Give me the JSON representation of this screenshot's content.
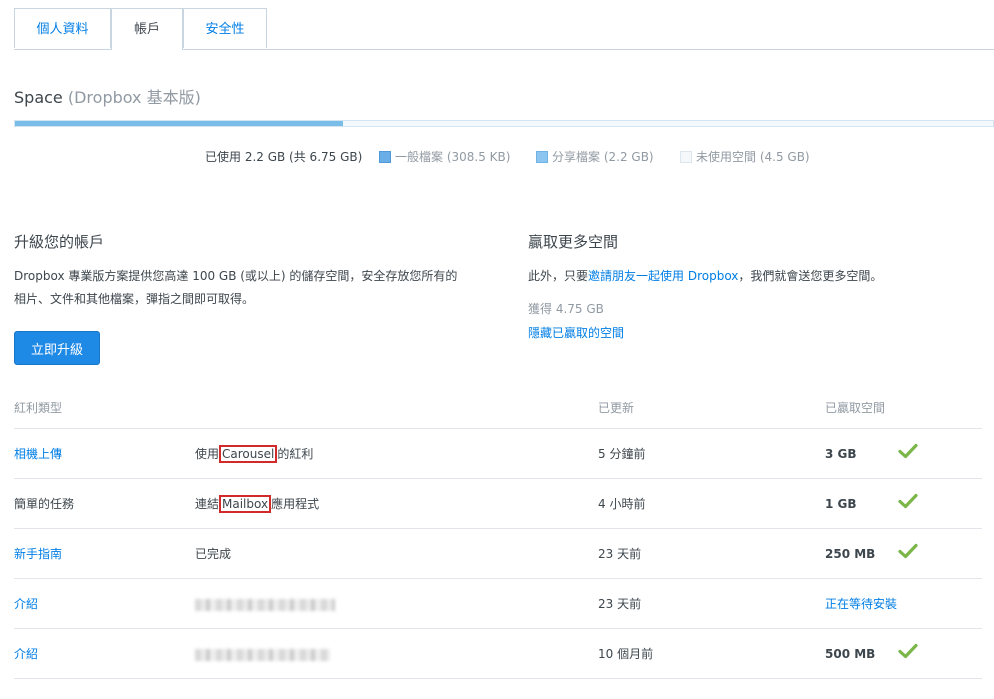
{
  "tabs": [
    {
      "label": "個人資料",
      "active": false
    },
    {
      "label": "帳戶",
      "active": true
    },
    {
      "label": "安全性",
      "active": false
    }
  ],
  "space": {
    "title": "Space",
    "plan": "(Dropbox 基本版)",
    "used_fraction": 0.335,
    "used_label": "已使用 2.2 GB (共 6.75 GB)",
    "legend": [
      {
        "label": "一般檔案 (308.5 KB)",
        "color": "#6aaee8"
      },
      {
        "label": "分享檔案 (2.2 GB)",
        "color": "#8cc6f0"
      },
      {
        "label": "未使用空間 (4.5 GB)",
        "color": "#f1f5f8"
      }
    ]
  },
  "upgrade": {
    "title": "升級您的帳戶",
    "text_line1": "Dropbox 專業版方案提供您高達 100 GB (或以上) 的儲存空間，安全存放您所有的",
    "text_line2": "相片、文件和其他檔案，彈指之間即可取得。",
    "button": "立即升級"
  },
  "earn": {
    "title": "贏取更多空間",
    "text_prefix": "此外，只要",
    "text_link": "邀請朋友一起使用 Dropbox",
    "text_suffix": "，我們就會送您更多空間。",
    "earned": "獲得 4.75 GB",
    "hide_link": "隱藏已贏取的空間"
  },
  "bonus_table": {
    "headers": [
      "紅利類型",
      "已更新",
      "已贏取空間"
    ],
    "rows": [
      {
        "type": "相機上傳",
        "type_link": true,
        "desc_prefix": "使用",
        "desc_box": "Carousel",
        "desc_suffix": "的紅利",
        "updated": "5 分鐘前",
        "space": "3 GB",
        "check": true
      },
      {
        "type": "簡單的任務",
        "type_link": false,
        "desc_prefix": "連結",
        "desc_box": "Mailbox",
        "desc_suffix": "應用程式",
        "updated": "4 小時前",
        "space": "1 GB",
        "check": true
      },
      {
        "type": "新手指南",
        "type_link": true,
        "desc_prefix": "已完成",
        "desc_box": "",
        "desc_suffix": "",
        "updated": "23 天前",
        "space": "250 MB",
        "check": true
      },
      {
        "type": "介紹",
        "type_link": true,
        "blurred": true,
        "updated": "23 天前",
        "space": "正在等待安裝",
        "space_link": true,
        "check": false
      },
      {
        "type": "介紹",
        "type_link": true,
        "blurred": true,
        "updated": "10 個月前",
        "space": "500 MB",
        "check": true
      }
    ]
  },
  "colors": {
    "accent": "#007ee5",
    "check": "#7ab648",
    "highlight_box": "#d02a2a"
  }
}
